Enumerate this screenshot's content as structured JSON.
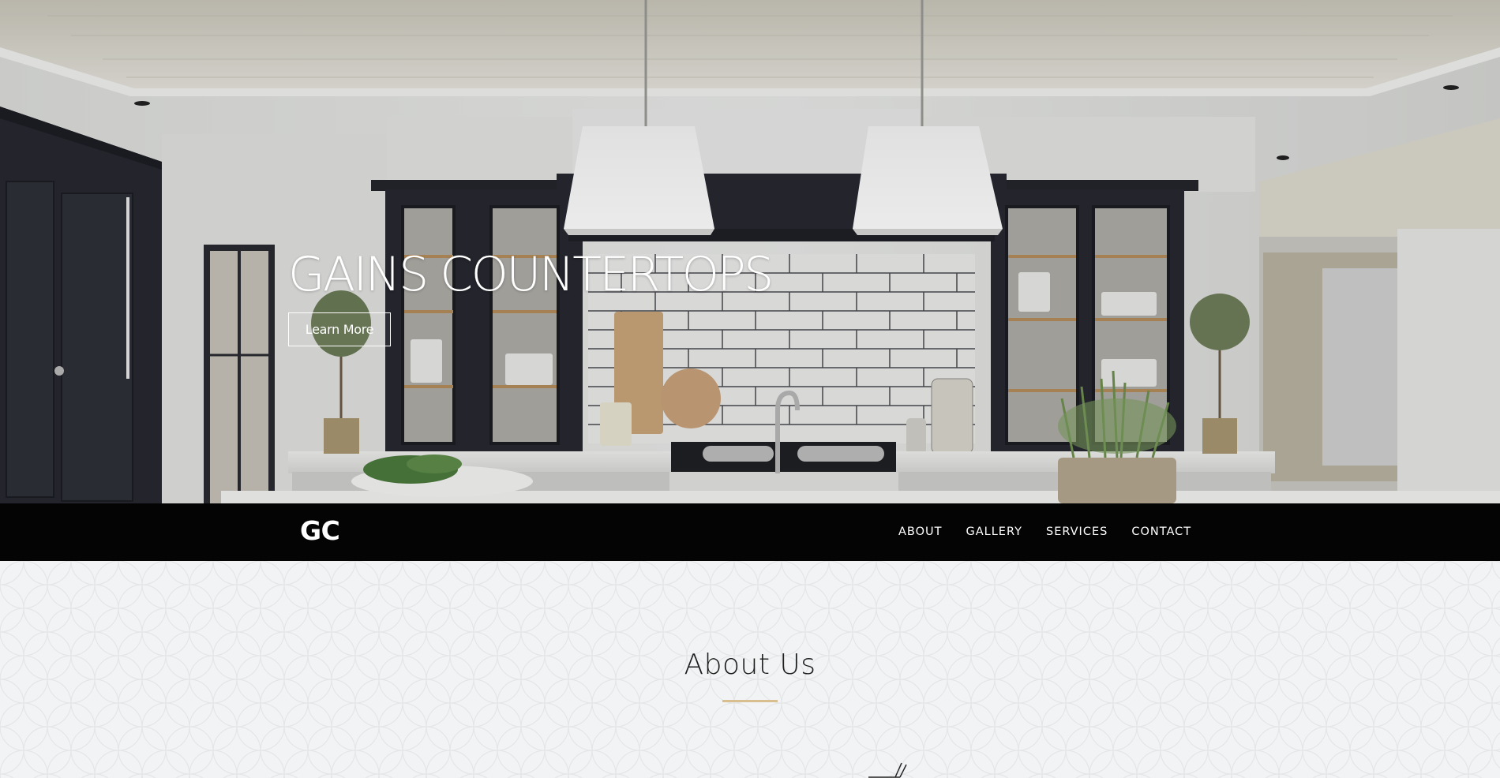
{
  "hero": {
    "title": "GAINS COUNTERTOPS",
    "cta_label": "Learn More"
  },
  "nav": {
    "logo": "GC",
    "links": [
      {
        "label": "ABOUT"
      },
      {
        "label": "GALLERY"
      },
      {
        "label": "SERVICES"
      },
      {
        "label": "CONTACT"
      }
    ]
  },
  "about": {
    "heading": "About Us",
    "accent_color": "#d9bf8f"
  },
  "colors": {
    "navbar_bg": "#040404",
    "nav_text": "#ffffff",
    "page_bg": "#f2f3f4",
    "cabinet": "#2a2c33"
  }
}
